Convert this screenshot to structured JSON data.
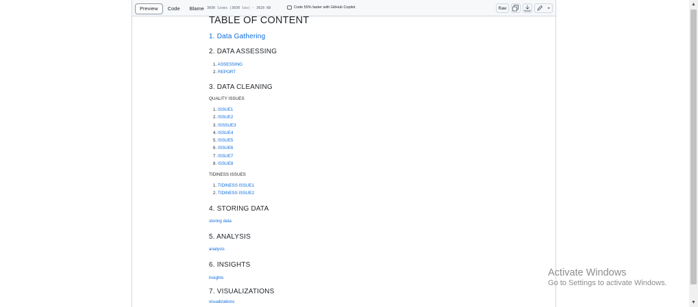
{
  "toolbar": {
    "views": [
      "Preview",
      "Code",
      "Blame"
    ],
    "active_view": "Preview",
    "file_meta": "3030 lines (3030 loc) · 3020 KB",
    "copilot_text": "Code 55% faster with GitHub Copilot",
    "raw_label": "Raw"
  },
  "content": {
    "title": "TABLE OF CONTENT",
    "sections": [
      {
        "heading": "1. Data Gathering"
      },
      {
        "heading": "2. DATA ASSESSING",
        "items": [
          "ASSESSING",
          "REPORT"
        ]
      },
      {
        "heading": "3. DATA CLEANING",
        "groups": [
          {
            "label": "QUALITY ISSUES",
            "items": [
              "ISSUE1",
              "ISSUE2",
              "ISSSUE3",
              "ISSUE4",
              "ISSUE5",
              "ISSUE6",
              "ISSUE7",
              "ISSUE8"
            ]
          },
          {
            "label": "TIDINESS ISSUES",
            "items": [
              "TIDINESS ISSUE1",
              "TIDINESS ISSUE2"
            ]
          }
        ]
      },
      {
        "heading": "4. STORING DATA",
        "link": "storing data"
      },
      {
        "heading": "5. ANALYSIS",
        "link": "analysis"
      },
      {
        "heading": "6. INSIGHTS",
        "link": "insights"
      },
      {
        "heading": "7. VISUALIZATIONS",
        "link": "visualizations"
      }
    ]
  },
  "watermark": {
    "line1": "Activate Windows",
    "line2": "Go to Settings to activate Windows."
  },
  "colors": {
    "link": "#0969da",
    "text": "#1f2328",
    "border": "#d0d7de"
  }
}
